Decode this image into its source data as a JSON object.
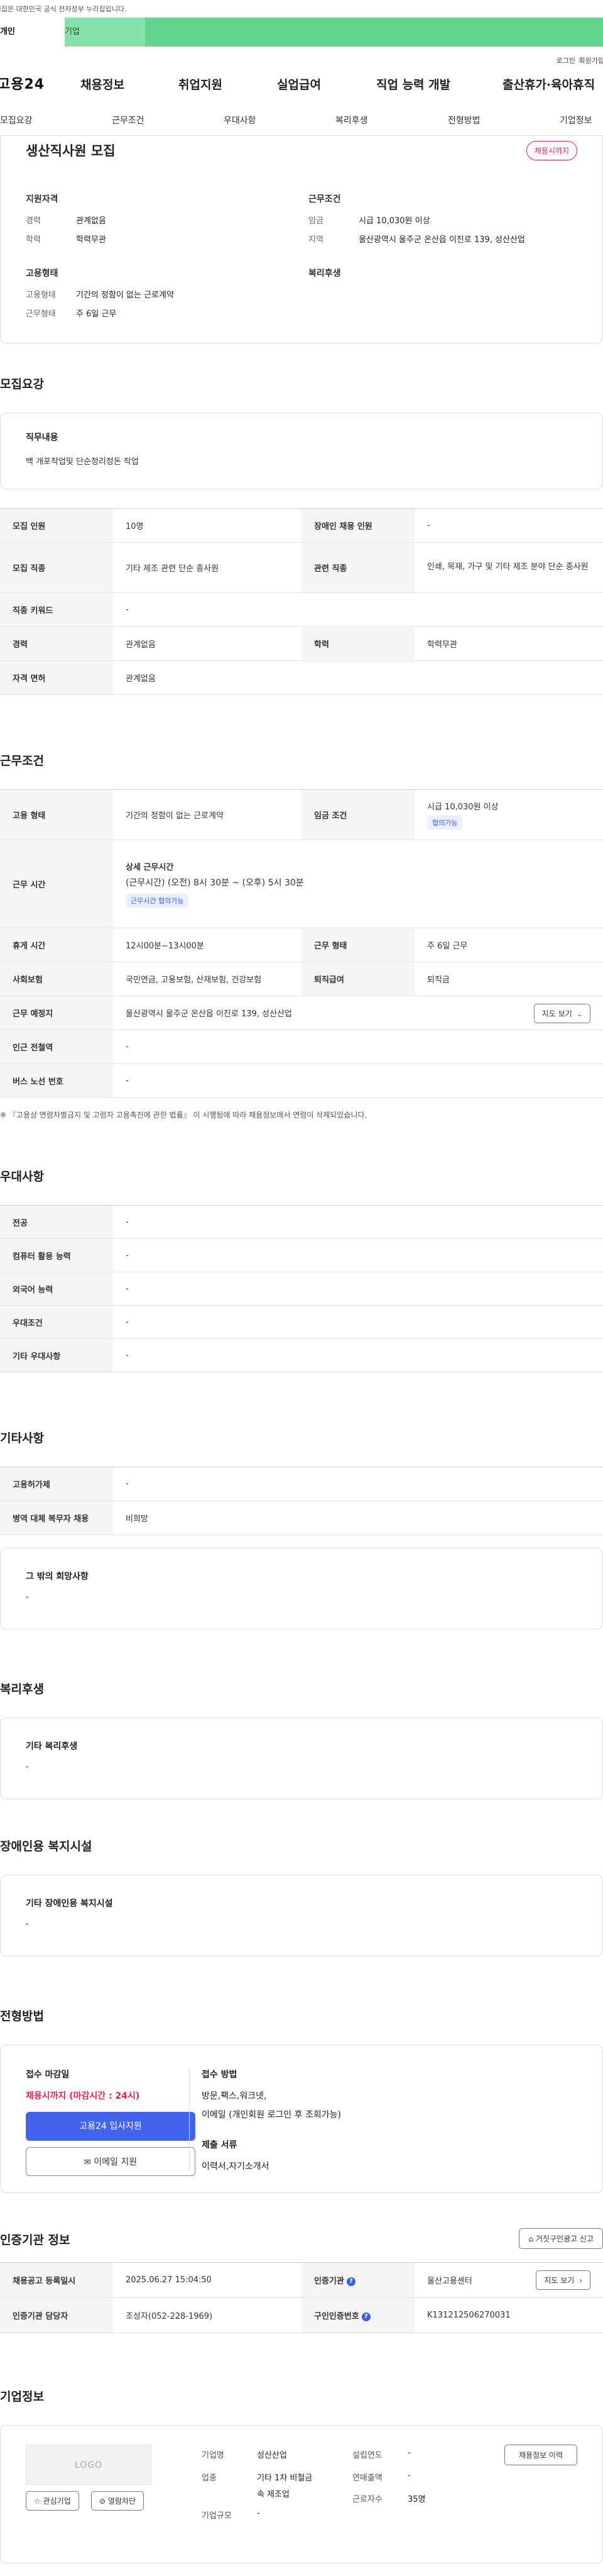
{
  "gov_banner": "이 누리집은 대한민국 공식 전자정부 누리집입니다.",
  "tabs": [
    "개인",
    "기업"
  ],
  "util": {
    "login": "로그인",
    "join": "회원가입"
  },
  "logo": "고용24",
  "gnb": [
    "채용정보",
    "취업지원",
    "실업급여",
    "직업 능력 개발",
    "출산휴가·육아휴직"
  ],
  "tabnav": [
    "모집요강",
    "근무조건",
    "우대사항",
    "복리후생",
    "전형방법",
    "기업정보"
  ],
  "summary": {
    "title": "생산직사원 모집",
    "status": "채용시까지",
    "qual_heading": "지원자격",
    "qual": [
      {
        "k": "경력",
        "v": "관계없음"
      },
      {
        "k": "학력",
        "v": "학력무관"
      }
    ],
    "work_heading": "근무조건",
    "work": [
      {
        "k": "임금",
        "v": "시급 10,030원 이상"
      },
      {
        "k": "지역",
        "v": "울산광역시 울주군 온산읍 이진로 139, 성산산업"
      }
    ],
    "emp_heading": "고용형태",
    "emp": [
      {
        "k": "고용형태",
        "v": "기간의 정함이 없는 근로계약"
      },
      {
        "k": "근무형태",
        "v": "주 6일 근무"
      }
    ],
    "welfare_heading": "복리후생"
  },
  "recruit": {
    "title": "모집요강",
    "duty_label": "직무내용",
    "duty_value": "백 개포작업및 단순정리정돈 작업",
    "rows": [
      {
        "k1": "모집 인원",
        "v1": "10명",
        "k2": "장애인 채용 인원",
        "v2": "-"
      },
      {
        "k1": "모집 직종",
        "v1": "기타 제조 관련 단순 종사원",
        "k2": "관련 직종",
        "v2": "인쇄, 목재, 가구 및 기타 제조 분야 단순 종사원"
      },
      {
        "k1": "직종 키워드",
        "v1": "-"
      },
      {
        "k1": "경력",
        "v1": "관계없음",
        "k2": "학력",
        "v2": "학력무관"
      },
      {
        "k1": "자격 면허",
        "v1": "관계없음"
      }
    ]
  },
  "work": {
    "title": "근무조건",
    "emp_label": "고용 형태",
    "emp_value": "기간의 정함이 없는 근로계약",
    "wage_label": "임금 조건",
    "wage_value": "시급 10,030원 이상",
    "wage_chip": "협의가능",
    "time_label": "근무 시간",
    "time_title": "상세 근무시간",
    "time_value": "(근무시간) (오전) 8시 30분 ~ (오후) 5시 30분",
    "time_chip": "근무시간 협의가능",
    "rest_label": "휴게 시간",
    "rest_value": "12시00분~13시00분",
    "shape_label": "근무 형태",
    "shape_value": "주 6일 근무",
    "ins_label": "사회보험",
    "ins_value": "국민연금, 고용보험, 산재보험, 건강보험",
    "sev_label": "퇴직급여",
    "sev_value": "퇴직금",
    "place_label": "근무 예정지",
    "place_value": "울산광역시 울주군 온산읍 이진로 139, 성산산업",
    "map_btn": "지도 보기",
    "subway_label": "인근 전철역",
    "subway_value": "-",
    "bus_label": "버스 노선 번호",
    "bus_value": "-",
    "note": "※ 『고용상 연령차별금지 및 고령자 고용촉진에 관한 법률』 이 시행됨에 따라 채용정보에서 연령이 삭제되었습니다."
  },
  "pref": {
    "title": "우대사항",
    "rows": [
      {
        "k": "전공",
        "v": "-"
      },
      {
        "k": "컴퓨터 활용 능력",
        "v": "-"
      },
      {
        "k": "외국어 능력",
        "v": "-"
      },
      {
        "k": "우대조건",
        "v": "-"
      },
      {
        "k": "기타 우대사항",
        "v": "-"
      }
    ]
  },
  "etc": {
    "title": "기타사항",
    "rows": [
      {
        "k": "고용허가제",
        "v": "-"
      },
      {
        "k": "병역 대체 복무자 채용",
        "v": "비희망"
      }
    ],
    "hope_label": "그 밖의 희망사항",
    "hope_value": "-"
  },
  "welfare": {
    "title": "복리후생",
    "label": "기타 복리후생",
    "value": "-"
  },
  "disab": {
    "title": "장애인용 복지시설",
    "label": "기타 장애인용 복지시설",
    "value": "-"
  },
  "screen": {
    "title": "전형방법",
    "deadline_label": "접수 마감일",
    "deadline_value": "채용시까지 (마감시간 : 24시)",
    "apply_btn": "고용24 입사지원",
    "email_btn": "이메일 지원",
    "method_label": "접수 방법",
    "method_value1": "방문,팩스,워크넷,",
    "method_value2": "이메일 (개인회원 로그인 후 조회가능)",
    "doc_label": "제출 서류",
    "doc_value": "이력서,자기소개서"
  },
  "cert": {
    "title": "인증기관 정보",
    "report_btn": "거짓구인광고 신고",
    "rows": [
      {
        "k1": "채용공고 등록일시",
        "v1": "2025.06.27 15:04:50",
        "k2": "인증기관",
        "v2": "울산고용센터",
        "btn": "지도 보기"
      },
      {
        "k1": "인증기관 담당자",
        "v1": "조성자(052-228-1969)",
        "k2": "구인인증번호",
        "v2": "K131212506270031"
      }
    ]
  },
  "company": {
    "title": "기업정보",
    "logo_text": "LOGO",
    "fav_btn": "관심기업",
    "block_btn": "열람차단",
    "name_label": "기업명",
    "name_value": "성산산업",
    "ind_label": "업종",
    "ind_value1": "기타 1차 비철금",
    "ind_value2": "속 제조업",
    "size_label": "기업규모",
    "size_value": "-",
    "year_label": "설립연도",
    "year_value": "-",
    "sales_label": "연매출액",
    "sales_value": "-",
    "emp_label": "근로자수",
    "emp_value": "35명",
    "history_btn": "채용정보 이력"
  }
}
